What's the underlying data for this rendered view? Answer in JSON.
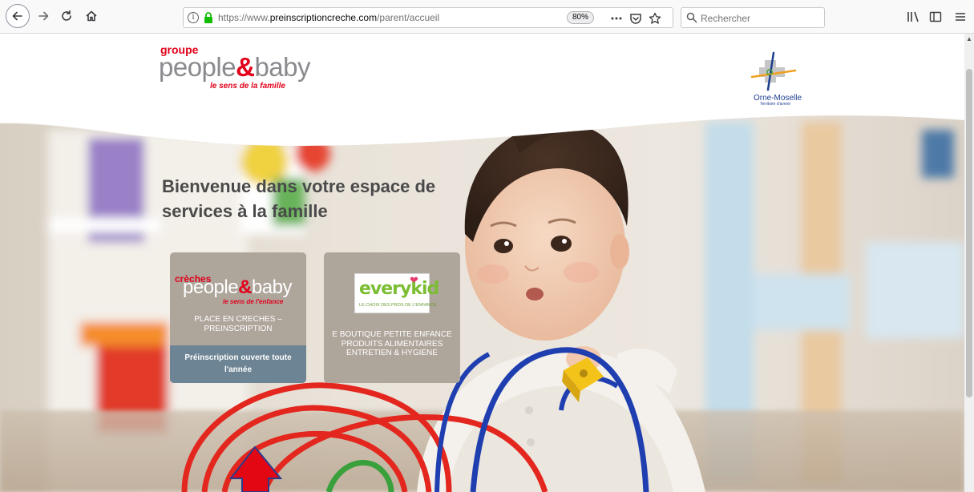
{
  "browser": {
    "url_prefix": "https://www.",
    "url_domain": "preinscriptioncreche.com",
    "url_path": "/parent/accueil",
    "zoom": "80%",
    "search_placeholder": "Rechercher"
  },
  "header": {
    "brand_group": "groupe",
    "brand_name_a": "people",
    "brand_amp": "&",
    "brand_name_b": "baby",
    "brand_tagline": "le sens de la famille",
    "partner_name": "Orne-Moselle",
    "partner_sub": "Territoire d'avenir"
  },
  "hero": {
    "welcome": "Bienvenue dans votre espace de services à la famille"
  },
  "tiles": [
    {
      "logo_small": "crèches",
      "logo_a": "people",
      "logo_amp": "&",
      "logo_b": "baby",
      "logo_tag": "le sens de l'enfance",
      "label": "PLACE EN CRECHES – PREINSCRIPTION",
      "note": "Préinscription ouverte toute l'année"
    },
    {
      "logo_word": "everykid",
      "logo_sub": "LE CHOIX DES PROS DE L'ENFANCE",
      "label": "E BOUTIQUE PETITE ENFANCE PRODUITS ALIMENTAIRES ENTRETIEN & HYGIENE"
    }
  ],
  "colors": {
    "brand_red": "#e2001a",
    "tile_bg": "#aea59b",
    "note_bg": "#6c8494",
    "everykid_green": "#7bbd33",
    "annotation_arrow": "#e30613"
  }
}
